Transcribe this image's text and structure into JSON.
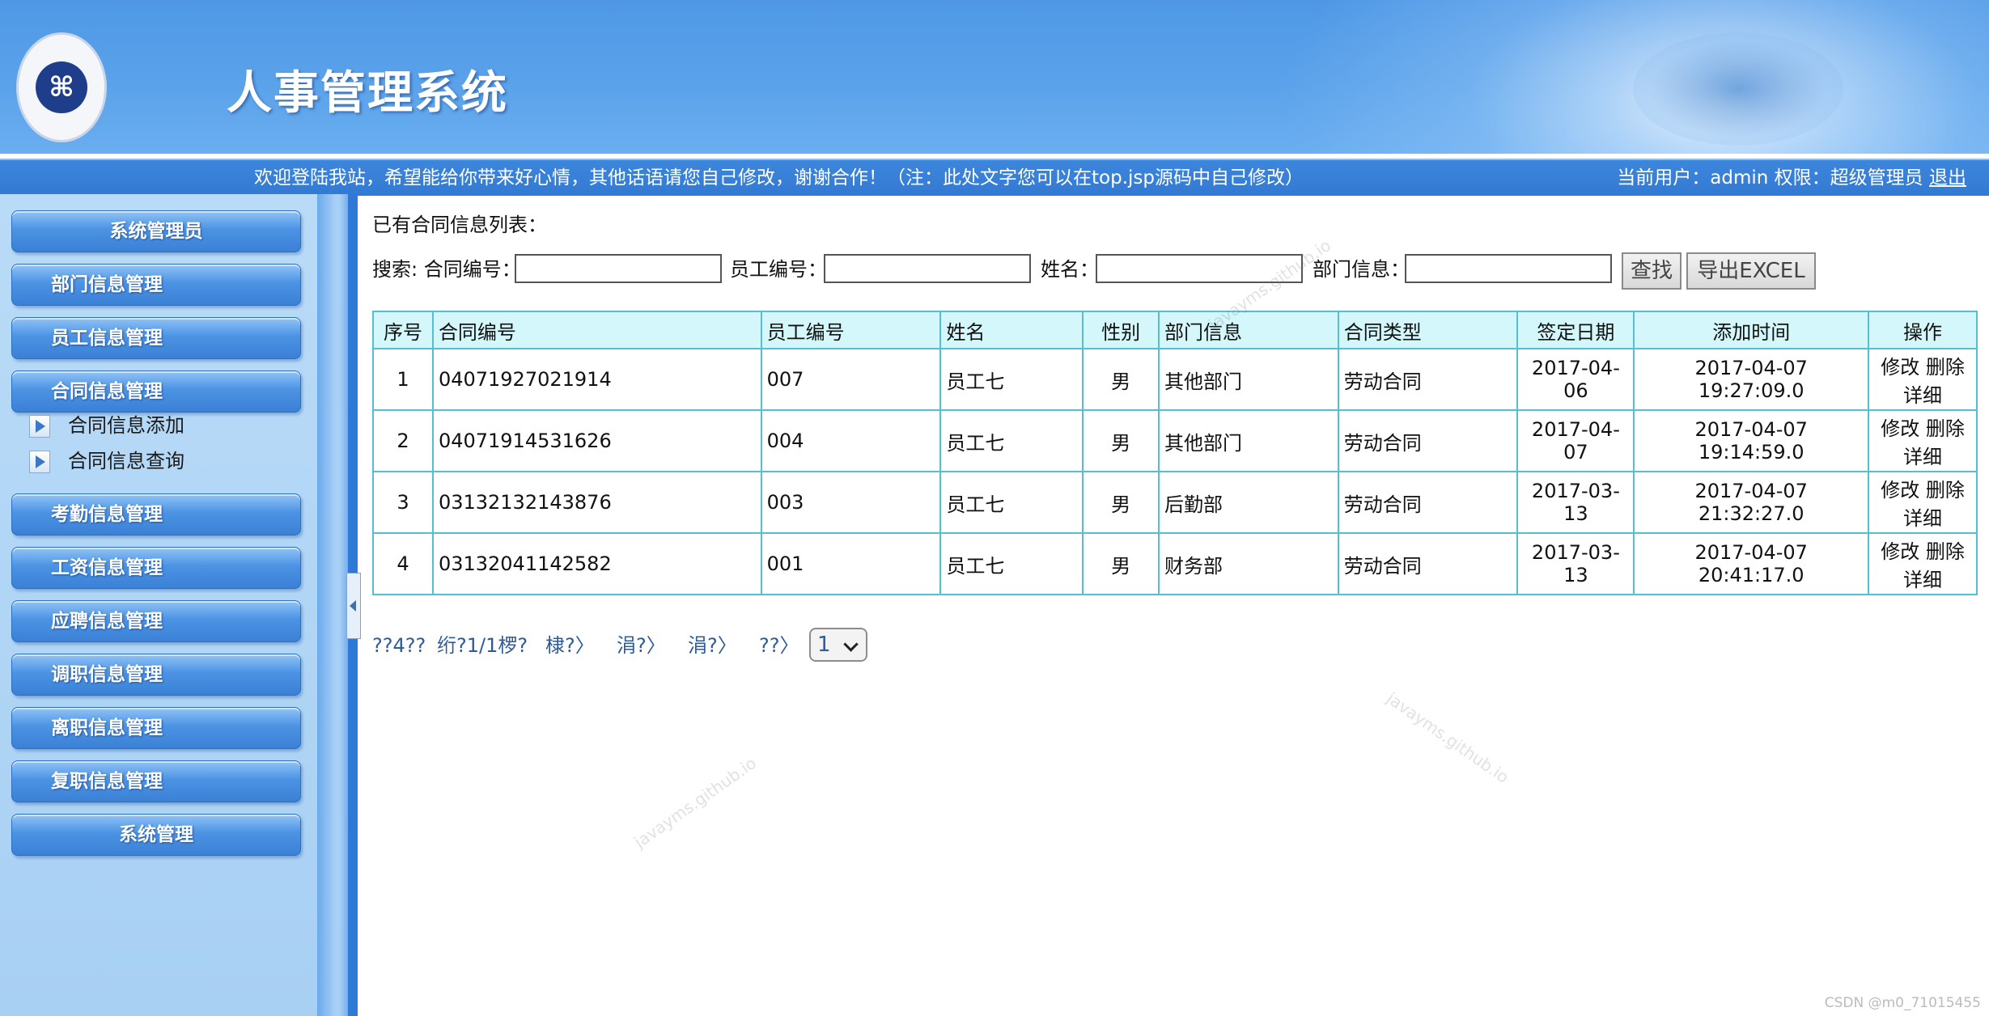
{
  "header": {
    "app_title": "人事管理系统",
    "welcome_text": "欢迎登陆我站，希望能给你带来好心情，其他话语请您自己修改，谢谢合作！（注：此处文字您可以在top.jsp源码中自己修改）",
    "user_info": "当前用户：admin 权限：超级管理员",
    "logout_label": "退出"
  },
  "sidebar": {
    "items": [
      {
        "label": "系统管理员"
      },
      {
        "label": "部门信息管理"
      },
      {
        "label": "员工信息管理"
      },
      {
        "label": "合同信息管理"
      },
      {
        "label": "考勤信息管理"
      },
      {
        "label": "工资信息管理"
      },
      {
        "label": "应聘信息管理"
      },
      {
        "label": "调职信息管理"
      },
      {
        "label": "离职信息管理"
      },
      {
        "label": "复职信息管理"
      },
      {
        "label": "系统管理"
      }
    ],
    "sub_items": [
      {
        "label": "合同信息添加"
      },
      {
        "label": "合同信息查询"
      }
    ]
  },
  "main": {
    "list_title": "已有合同信息列表：",
    "search": {
      "prefix": "搜索: 合同编号：",
      "employee_no_label": "员工编号：",
      "name_label": "姓名：",
      "dept_label": "部门信息：",
      "search_button": "查找",
      "export_button": "导出EXCEL"
    },
    "table": {
      "headers": [
        "序号",
        "合同编号",
        "员工编号",
        "姓名",
        "性别",
        "部门信息",
        "合同类型",
        "签定日期",
        "添加时间",
        "操作"
      ],
      "rows": [
        {
          "no": "1",
          "contract_no": "04071927021914",
          "emp_no": "007",
          "name": "员工七",
          "gender": "男",
          "dept": "其他部门",
          "type": "劳动合同",
          "sign_date": "2017-04-06",
          "added": "2017-04-07 19:27:09.0"
        },
        {
          "no": "2",
          "contract_no": "04071914531626",
          "emp_no": "004",
          "name": "员工七",
          "gender": "男",
          "dept": "其他部门",
          "type": "劳动合同",
          "sign_date": "2017-04-07",
          "added": "2017-04-07 19:14:59.0"
        },
        {
          "no": "3",
          "contract_no": "03132132143876",
          "emp_no": "003",
          "name": "员工七",
          "gender": "男",
          "dept": "后勤部",
          "type": "劳动合同",
          "sign_date": "2017-03-13",
          "added": "2017-04-07 21:32:27.0"
        },
        {
          "no": "4",
          "contract_no": "03132041142582",
          "emp_no": "001",
          "name": "员工七",
          "gender": "男",
          "dept": "财务部",
          "type": "劳动合同",
          "sign_date": "2017-03-13",
          "added": "2017-04-07 20:41:17.0"
        }
      ],
      "op_edit": "修改",
      "op_delete": "删除",
      "op_detail": "详细"
    },
    "pager": {
      "items": [
        "??4??",
        "绗?1/1椤?",
        "棣?〉",
        "涓?〉",
        "涓?〉",
        "??〉"
      ],
      "selected_page": "1"
    }
  },
  "watermark": "javayms.github.io",
  "footer_credit": "CSDN @m0_71015455",
  "colors": {
    "header_blue": "#4f98e6",
    "bar_blue": "#3279d3",
    "sidebar_bg": "#b9dbf7",
    "table_header_bg": "#d4f7fb",
    "table_border": "#53bfd0"
  }
}
